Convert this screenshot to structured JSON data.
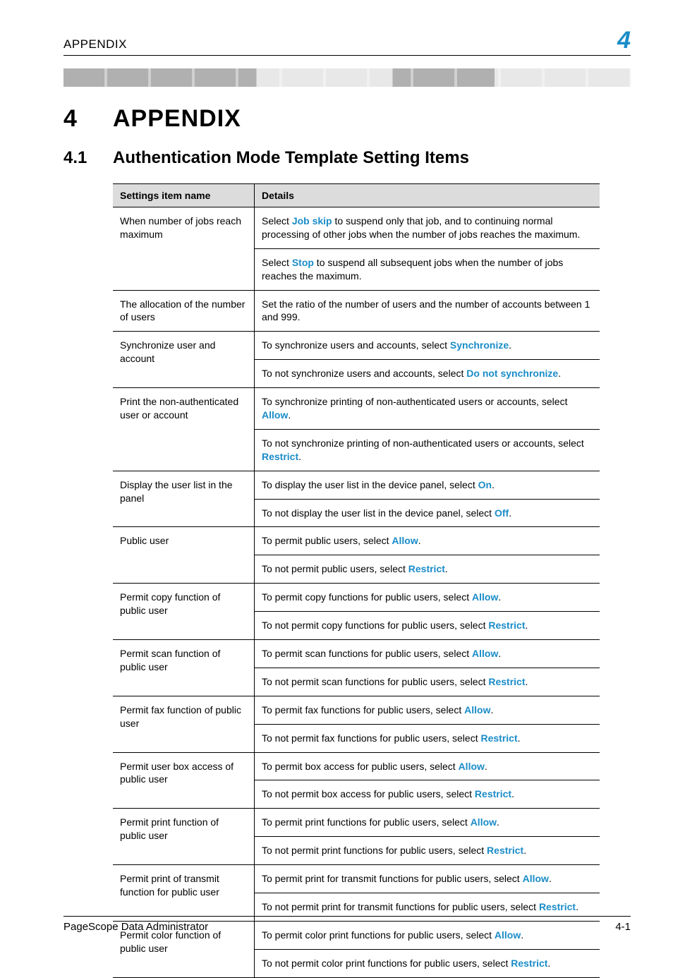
{
  "header": {
    "running": "APPENDIX",
    "badge": "4"
  },
  "chapter": {
    "num": "4",
    "title": "APPENDIX"
  },
  "section": {
    "num": "4.1",
    "title": "Authentication Mode Template Setting Items"
  },
  "table": {
    "headers": {
      "name": "Settings item name",
      "details": "Details"
    },
    "rows": [
      {
        "name": "When number of jobs reach maximum",
        "details": [
          {
            "pre": "Select ",
            "kw": "Job skip",
            "post": " to suspend only that job, and to continuing normal processing of other jobs when the number of jobs reaches the maximum."
          },
          {
            "pre": "Select ",
            "kw": "Stop",
            "post": " to suspend all subsequent jobs when the number of jobs reaches the maximum."
          }
        ]
      },
      {
        "name": "The allocation of the number of users",
        "details": [
          {
            "pre": "Set the ratio of the number of users and the number of accounts between 1 and 999.",
            "kw": "",
            "post": ""
          }
        ]
      },
      {
        "name": "Synchronize user and account",
        "details": [
          {
            "pre": "To synchronize users and accounts, select ",
            "kw": "Synchronize",
            "post": "."
          },
          {
            "pre": "To not synchronize users and accounts, select ",
            "kw": "Do not synchronize",
            "post": "."
          }
        ]
      },
      {
        "name": "Print the non-authenticated user or account",
        "details": [
          {
            "pre": "To synchronize printing of non-authenticated users or accounts, select ",
            "kw": "Allow",
            "post": "."
          },
          {
            "pre": "To not synchronize printing of non-authenticated users or accounts, select ",
            "kw": "Restrict",
            "post": "."
          }
        ]
      },
      {
        "name": "Display the user list in the panel",
        "details": [
          {
            "pre": "To display the user list in the device panel, select ",
            "kw": "On",
            "post": "."
          },
          {
            "pre": "To not display the user list in the device panel, select ",
            "kw": "Off",
            "post": "."
          }
        ]
      },
      {
        "name": "Public user",
        "details": [
          {
            "pre": "To permit public users, select ",
            "kw": "Allow",
            "post": "."
          },
          {
            "pre": "To not permit public users, select ",
            "kw": "Restrict",
            "post": "."
          }
        ]
      },
      {
        "name": "Permit copy function of public user",
        "details": [
          {
            "pre": "To permit copy functions for public users, select ",
            "kw": "Allow",
            "post": "."
          },
          {
            "pre": "To not permit copy functions for public users, select ",
            "kw": "Restrict",
            "post": "."
          }
        ]
      },
      {
        "name": "Permit scan function of public user",
        "details": [
          {
            "pre": "To permit scan functions for public users, select ",
            "kw": "Allow",
            "post": "."
          },
          {
            "pre": "To not permit scan functions for public users, select ",
            "kw": "Restrict",
            "post": "."
          }
        ]
      },
      {
        "name": "Permit fax function of public user",
        "details": [
          {
            "pre": "To permit fax functions for public users, select ",
            "kw": "Allow",
            "post": "."
          },
          {
            "pre": "To not permit fax functions for public users, select ",
            "kw": "Restrict",
            "post": "."
          }
        ]
      },
      {
        "name": "Permit user box access of public user",
        "details": [
          {
            "pre": "To permit box access for public users, select ",
            "kw": "Allow",
            "post": "."
          },
          {
            "pre": "To not permit box access for public users, select ",
            "kw": "Restrict",
            "post": "."
          }
        ]
      },
      {
        "name": "Permit print function of public user",
        "details": [
          {
            "pre": "To permit print functions for public users, select ",
            "kw": "Allow",
            "post": "."
          },
          {
            "pre": "To not permit print functions for public users, select ",
            "kw": "Restrict",
            "post": "."
          }
        ]
      },
      {
        "name": "Permit print of transmit function for public user",
        "details": [
          {
            "pre": "To permit print for transmit functions for public users, select ",
            "kw": "Allow",
            "post": "."
          },
          {
            "pre": "To not permit print for transmit functions for public users, select ",
            "kw": "Restrict",
            "post": "."
          }
        ]
      },
      {
        "name": "Permit color function of public user",
        "details": [
          {
            "pre": "To permit color print functions for public users, select ",
            "kw": "Allow",
            "post": "."
          },
          {
            "pre": "To not permit color print functions for public users, select ",
            "kw": "Restrict",
            "post": "."
          }
        ]
      }
    ]
  },
  "footer": {
    "product": "PageScope Data Administrator",
    "page": "4-1"
  }
}
